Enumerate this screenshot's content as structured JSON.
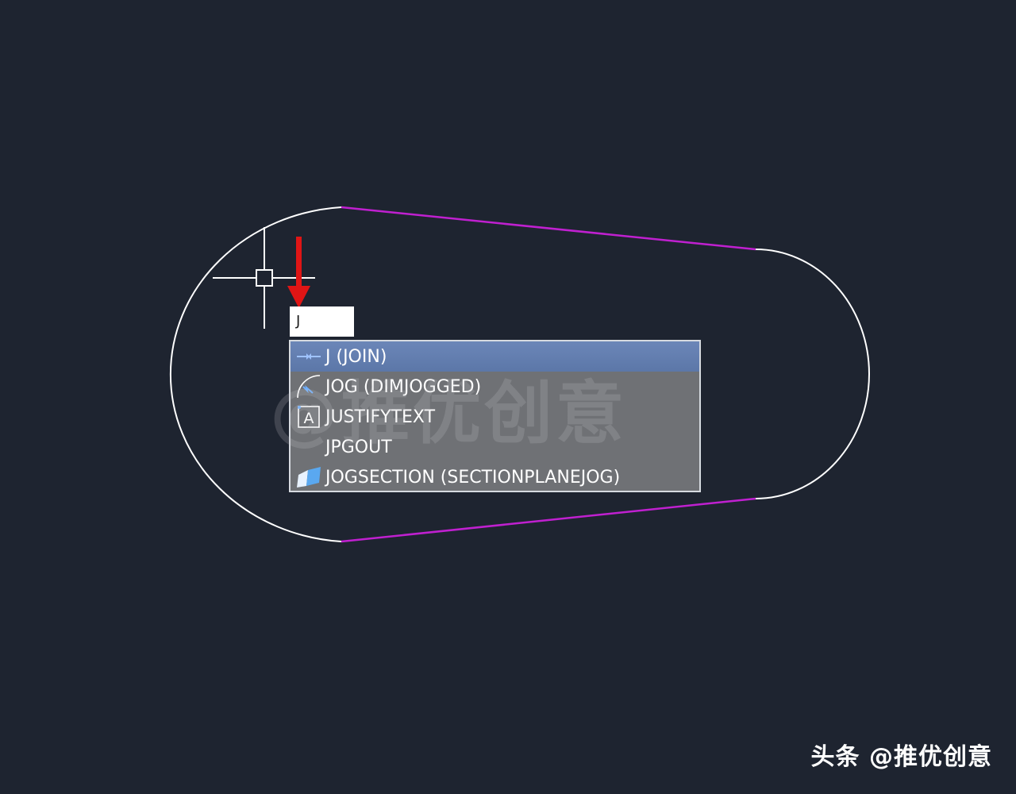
{
  "command_line": {
    "input_value": "J"
  },
  "autocomplete": {
    "items": [
      {
        "label": "J (JOIN)",
        "icon": "join-icon",
        "selected": true
      },
      {
        "label": "JOG (DIMJOGGED)",
        "icon": "dimjogged-icon",
        "selected": false
      },
      {
        "label": "JUSTIFYTEXT",
        "icon": "justifytext-icon",
        "selected": false
      },
      {
        "label": "JPGOUT",
        "icon": "",
        "selected": false
      },
      {
        "label": "JOGSECTION (SECTIONPLANEJOG)",
        "icon": "sectionplanejog-icon",
        "selected": false
      }
    ],
    "overlay_watermark": "@推优创意"
  },
  "watermark": {
    "text": "头条 @推优创意"
  },
  "colors": {
    "canvas_background": "#1e2430",
    "arc_color": "#ffffff",
    "line_color": "#c020d0",
    "arrow_color": "#e01515",
    "selection_color": "#6b86b8"
  }
}
